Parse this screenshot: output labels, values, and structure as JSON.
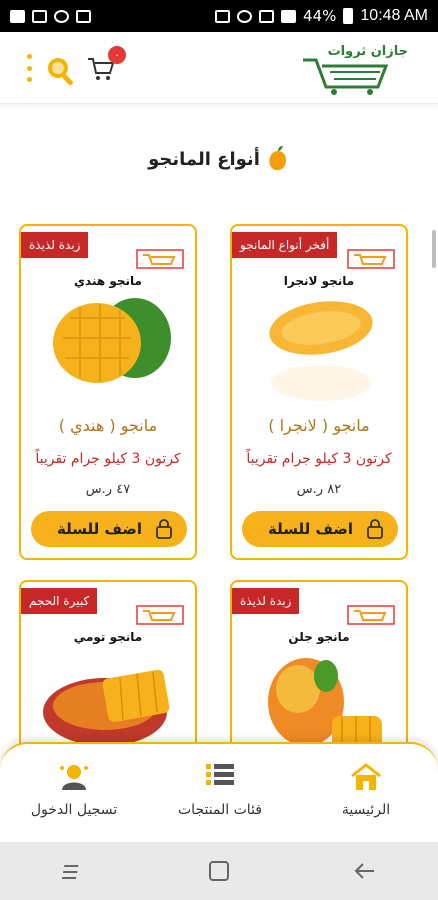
{
  "status_bar": {
    "battery": "44%",
    "time": "10:48 AM"
  },
  "header": {
    "cart_badge": "٠",
    "logo_text": "جازان ثروات"
  },
  "section": {
    "title": "أنواع المانجو"
  },
  "products": [
    {
      "ribbon": "أفخر أنواع المانجو",
      "label": "مانجو لانجرا",
      "name": "مانجو ( لانجرا )",
      "desc": "كرتون 3 كيلو جرام تقريباً",
      "price": "٨٢ ر.س",
      "button": "اضف للسلة"
    },
    {
      "ribbon": "زبدة لذيذة",
      "label": "مانجو هندي",
      "name": "مانجو ( هندي )",
      "desc": "كرتون 3 كيلو جرام تقريباً",
      "price": "٤٧ ر.س",
      "button": "اضف للسلة"
    },
    {
      "ribbon": "زبدة لذيذة",
      "label": "مانجو جلن"
    },
    {
      "ribbon": "كبيرة الحجم",
      "label": "مانجو تومي"
    }
  ],
  "bottom_nav": [
    {
      "label": "الرئيسية",
      "icon": "home-icon"
    },
    {
      "label": "فئات المنتجات",
      "icon": "list-icon"
    },
    {
      "label": "تسجيل الدخول",
      "icon": "user-icon"
    }
  ],
  "colors": {
    "accent": "#f5b400",
    "button": "#f7b11b",
    "ribbon": "#c62828",
    "name": "#b0741a"
  }
}
